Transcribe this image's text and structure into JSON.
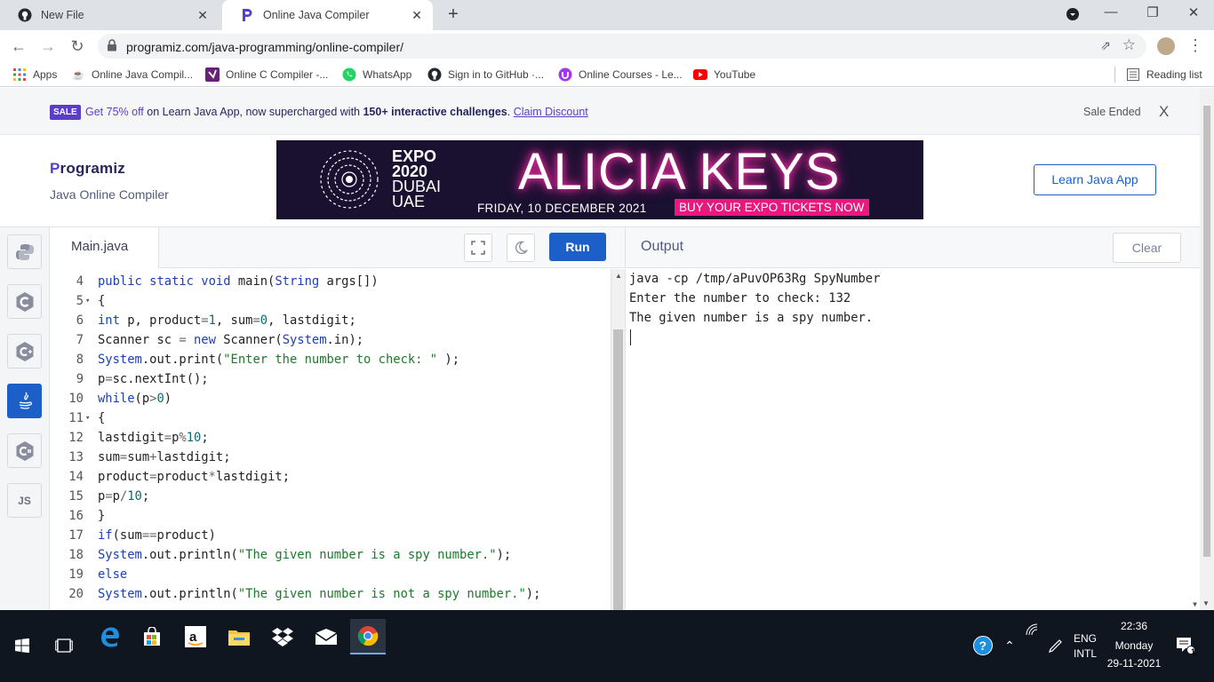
{
  "browser": {
    "tabs": [
      {
        "title": "New File",
        "icon": "github-icon"
      },
      {
        "title": "Online Java Compiler",
        "icon": "programiz-icon"
      }
    ],
    "url": "programiz.com/java-programming/online-compiler/",
    "bookmarks": [
      {
        "label": "Apps",
        "icon": "apps-grid-icon"
      },
      {
        "label": "Online Java Compil...",
        "icon": "java-icon"
      },
      {
        "label": "Online C Compiler -...",
        "icon": "visualstudio-icon"
      },
      {
        "label": "WhatsApp",
        "icon": "whatsapp-icon"
      },
      {
        "label": "Sign in to GitHub ·...",
        "icon": "github-icon"
      },
      {
        "label": "Online Courses - Le...",
        "icon": "udemy-icon"
      },
      {
        "label": "YouTube",
        "icon": "youtube-icon"
      }
    ],
    "reading_list": "Reading list"
  },
  "promo": {
    "badge": "SALE",
    "offer": "Get 75% off",
    "text_mid": " on Learn Java App, now supercharged with ",
    "bold": "150+ interactive challenges",
    "text_end": ". ",
    "link": "Claim Discount",
    "status": "Sale Ended",
    "close": "X"
  },
  "header": {
    "logo_p": "P",
    "logo_rest": "rogramiz",
    "subtitle": "Java Online Compiler",
    "learn_button": "Learn Java App"
  },
  "banner": {
    "expo_line1": "EXPO",
    "expo_line2": "2020",
    "expo_line3": "DUBAI",
    "expo_line4": "UAE",
    "headline": "ALICIA KEYS",
    "date": "FRIDAY, 10 DECEMBER 2021",
    "cta": "BUY YOUR EXPO TICKETS NOW"
  },
  "editor": {
    "file_tab": "Main.java",
    "run_label": "Run",
    "lines": [
      {
        "n": "4",
        "fold": "",
        "code": [
          [
            "kw",
            "public static void "
          ],
          [
            "",
            "main("
          ],
          [
            "cls",
            "String"
          ],
          [
            "",
            " args[])"
          ]
        ]
      },
      {
        "n": "5",
        "fold": "▾",
        "code": [
          [
            "",
            "{"
          ]
        ]
      },
      {
        "n": "6",
        "fold": "",
        "code": [
          [
            "kw",
            "int"
          ],
          [
            "",
            " p, product"
          ],
          [
            "op",
            "="
          ],
          [
            "num",
            "1"
          ],
          [
            "",
            ", sum"
          ],
          [
            "op",
            "="
          ],
          [
            "num",
            "0"
          ],
          [
            "",
            ", lastdigit;"
          ]
        ]
      },
      {
        "n": "7",
        "fold": "",
        "code": [
          [
            "",
            "Scanner sc "
          ],
          [
            "op",
            "="
          ],
          [
            "kw",
            " new "
          ],
          [
            "",
            "Scanner("
          ],
          [
            "cls",
            "System"
          ],
          [
            "",
            ".in);"
          ]
        ]
      },
      {
        "n": "8",
        "fold": "",
        "code": [
          [
            "cls",
            "System"
          ],
          [
            "",
            ".out.print("
          ],
          [
            "str",
            "\"Enter the number to check: \""
          ],
          [
            "",
            " );"
          ]
        ]
      },
      {
        "n": "9",
        "fold": "",
        "code": [
          [
            "",
            "p"
          ],
          [
            "op",
            "="
          ],
          [
            "",
            "sc.nextInt();"
          ]
        ]
      },
      {
        "n": "10",
        "fold": "",
        "code": [
          [
            "kw",
            "while"
          ],
          [
            "",
            "(p"
          ],
          [
            "op",
            ">"
          ],
          [
            "num",
            "0"
          ],
          [
            "",
            ")"
          ]
        ]
      },
      {
        "n": "11",
        "fold": "▾",
        "code": [
          [
            "",
            "{"
          ]
        ]
      },
      {
        "n": "12",
        "fold": "",
        "code": [
          [
            "",
            "lastdigit"
          ],
          [
            "op",
            "="
          ],
          [
            "",
            "p"
          ],
          [
            "op",
            "%"
          ],
          [
            "num",
            "10"
          ],
          [
            "",
            ";"
          ]
        ]
      },
      {
        "n": "13",
        "fold": "",
        "code": [
          [
            "",
            "sum"
          ],
          [
            "op",
            "="
          ],
          [
            "",
            "sum"
          ],
          [
            "op",
            "+"
          ],
          [
            "",
            "lastdigit;"
          ]
        ]
      },
      {
        "n": "14",
        "fold": "",
        "code": [
          [
            "",
            "product"
          ],
          [
            "op",
            "="
          ],
          [
            "",
            "product"
          ],
          [
            "op",
            "*"
          ],
          [
            "",
            "lastdigit;"
          ]
        ]
      },
      {
        "n": "15",
        "fold": "",
        "code": [
          [
            "",
            "p"
          ],
          [
            "op",
            "="
          ],
          [
            "",
            "p"
          ],
          [
            "op",
            "/"
          ],
          [
            "num",
            "10"
          ],
          [
            "",
            ";"
          ]
        ]
      },
      {
        "n": "16",
        "fold": "",
        "code": [
          [
            "",
            "}"
          ]
        ]
      },
      {
        "n": "17",
        "fold": "",
        "code": [
          [
            "kw",
            "if"
          ],
          [
            "",
            "(sum"
          ],
          [
            "op",
            "=="
          ],
          [
            "",
            "product)"
          ]
        ]
      },
      {
        "n": "18",
        "fold": "",
        "code": [
          [
            "cls",
            "System"
          ],
          [
            "",
            ".out.println("
          ],
          [
            "str",
            "\"The given number is a spy number.\""
          ],
          [
            "",
            ");"
          ]
        ]
      },
      {
        "n": "19",
        "fold": "",
        "code": [
          [
            "kw",
            "else"
          ]
        ]
      },
      {
        "n": "20",
        "fold": "",
        "code": [
          [
            "cls",
            "System"
          ],
          [
            "",
            ".out.println("
          ],
          [
            "str",
            "\"The given number is not a spy number.\""
          ],
          [
            "",
            ");"
          ]
        ]
      }
    ]
  },
  "output": {
    "title": "Output",
    "clear_label": "Clear",
    "lines": [
      "java -cp /tmp/aPuvOP63Rg SpyNumber",
      "Enter the number to check: 132",
      "The given number is a spy number."
    ]
  },
  "languages": [
    "python-icon",
    "c-icon",
    "cpp-icon",
    "java-icon",
    "csharp-icon",
    "javascript-icon"
  ],
  "taskbar": {
    "lang_1": "ENG",
    "lang_2": "INTL",
    "time": "22:36",
    "day": "Monday",
    "date": "29-11-2021",
    "notifications": "1"
  }
}
